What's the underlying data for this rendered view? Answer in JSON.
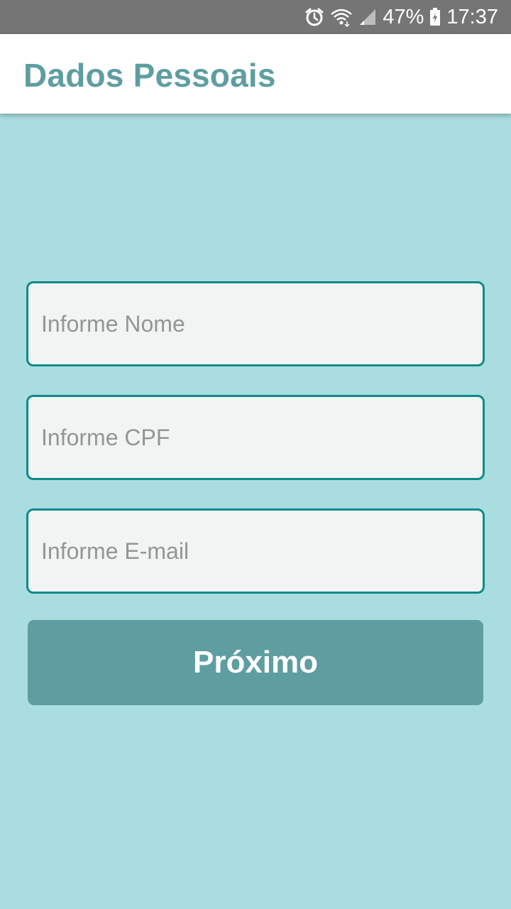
{
  "status_bar": {
    "battery": "47%",
    "time": "17:37",
    "icons": [
      "alarm-icon",
      "wifi-icon",
      "signal-icon",
      "battery-icon"
    ]
  },
  "app_bar": {
    "title": "Dados Pessoais",
    "title_color": "#5f9ea0"
  },
  "form": {
    "name_placeholder": "Informe Nome",
    "cpf_placeholder": "Informe CPF",
    "email_placeholder": "Informe E-mail",
    "next_label": "Próximo"
  },
  "colors": {
    "background": "#aadddf",
    "field_border": "#0f8a8c",
    "field_fill": "#f0f4f3",
    "button": "#5f9ea0",
    "status_bar": "#757575"
  }
}
